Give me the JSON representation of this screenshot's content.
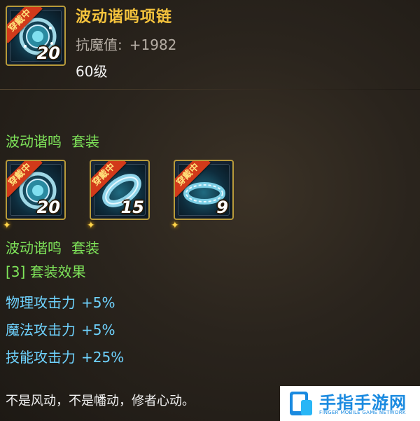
{
  "item": {
    "name": "波动谐鸣项链",
    "stat_label": "抗魔值:",
    "stat_value": "+1982",
    "level_req": "60级",
    "icon": "necklace-icon",
    "enhance_level": "20",
    "equipped_badge": "穿戴中"
  },
  "set": {
    "name": "波动谐鸣",
    "suffix": "套装",
    "pieces": [
      {
        "icon": "necklace-icon",
        "enhance_level": "20",
        "badge": "穿戴中"
      },
      {
        "icon": "bracelet-icon",
        "enhance_level": "15",
        "badge": "穿戴中"
      },
      {
        "icon": "ring-icon",
        "enhance_level": "9",
        "badge": "穿戴中"
      }
    ],
    "effect_title": "[3] 套装效果",
    "bonuses": [
      {
        "label": "物理攻击力",
        "value": "+5%"
      },
      {
        "label": "魔法攻击力",
        "value": "+5%"
      },
      {
        "label": "技能攻击力",
        "value": "+25%"
      }
    ]
  },
  "flavor_text": "不是风动，不是幡动，修者心动。",
  "watermark": {
    "cn": "手指手游网",
    "en": "FINGER MOBILE GAME NETWORK"
  },
  "colors": {
    "title_gold": "#f5c33d",
    "set_green": "#7fe55a",
    "bonus_blue": "#6fd3ff"
  }
}
